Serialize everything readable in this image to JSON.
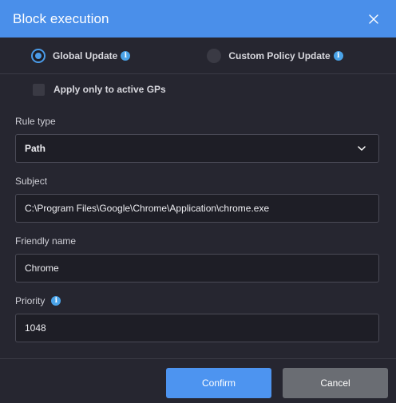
{
  "dialog": {
    "title": "Block execution",
    "close_icon": "close-icon"
  },
  "update_options": {
    "global": {
      "label": "Global Update",
      "checked": true
    },
    "custom": {
      "label": "Custom Policy Update",
      "checked": false
    }
  },
  "apply_active": {
    "label": "Apply only to active GPs",
    "checked": false
  },
  "fields": {
    "rule_type": {
      "label": "Rule type",
      "value": "Path"
    },
    "subject": {
      "label": "Subject",
      "value": "C:\\Program Files\\Google\\Chrome\\Application\\chrome.exe"
    },
    "friendly_name": {
      "label": "Friendly name",
      "value": "Chrome"
    },
    "priority": {
      "label": "Priority",
      "value": "1048"
    }
  },
  "buttons": {
    "confirm": "Confirm",
    "cancel": "Cancel"
  },
  "colors": {
    "header": "#4a8fea",
    "accent": "#4a9be8",
    "confirm": "#4d94f0",
    "cancel": "#6a6d73",
    "background": "#262630"
  }
}
